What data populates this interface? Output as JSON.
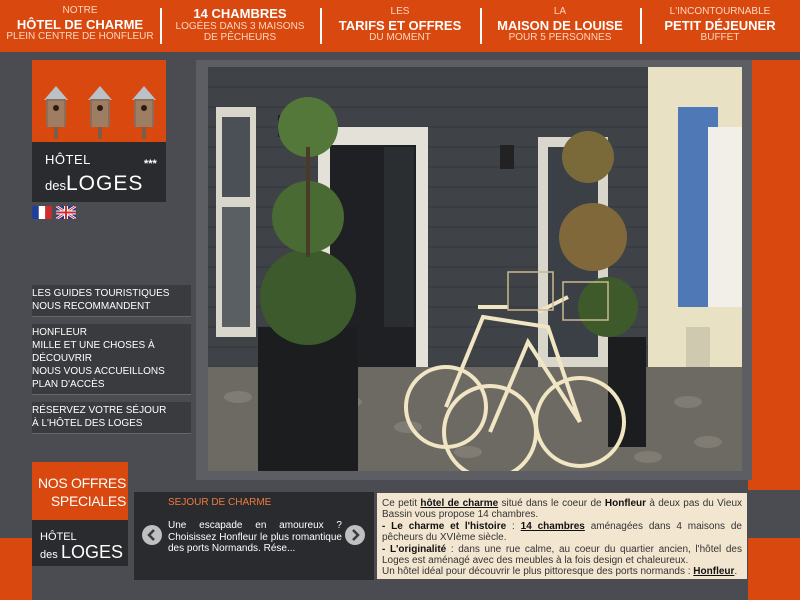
{
  "nav": [
    {
      "line1": "Notre",
      "line2": "Hôtel de charme",
      "line3": "Plein centre de Honfleur"
    },
    {
      "line1": "14 chambres",
      "line2": "logées dans 3 maisons",
      "line3": "de pêcheurs"
    },
    {
      "line1": "Les",
      "line2": "tarifs et offres",
      "line3": "du moment"
    },
    {
      "line1": "La",
      "line2": "Maison de Louise",
      "line3": "pour 5 personnes"
    },
    {
      "line1": "L'incontournable",
      "line2": "Petit Déjeuner",
      "line3": "Buffet"
    }
  ],
  "logo": {
    "hotel": "HÔTEL",
    "des": "des",
    "loges": "LOGES",
    "stars": "***"
  },
  "flags": {
    "fr": "french-flag-icon",
    "en": "uk-flag-icon"
  },
  "menu": [
    {
      "line1": "Les guides touristiques",
      "line2": "nous recommandent"
    },
    {
      "line1": "Honfleur",
      "line2": "mille et une choses à découvrir"
    },
    {
      "line1": "Nous vous accueillons",
      "line2": "plan d'accès"
    },
    {
      "line1": "Réservez votre séjour",
      "line2": "à l'hôtel des Loges"
    }
  ],
  "offers": {
    "title": "Nos offres speciales",
    "logo_hotel": "HÔTEL",
    "logo_des": "des",
    "logo_loges": "LOGES"
  },
  "slider": {
    "title": "Sejour de charme",
    "text": "Une escapade en amoureux ? Choisissez Honfleur le plus romantique des ports Normands. Rése..."
  },
  "description": {
    "p1_a": "Ce petit ",
    "p1_link": "hôtel de charme",
    "p1_b": " situé dans le coeur de ",
    "p1_bold": "Honfleur",
    "p1_c": " à deux pas du Vieux Bassin vous propose 14 chambres.",
    "p2_bold": "- Le charme et l'histoire",
    "p2_a": " : ",
    "p2_link": "14 chambres",
    "p2_b": " aménagées dans 4 maisons de pêcheurs du XVIème siècle.",
    "p3_bold": "- L'originalité",
    "p3_a": " : dans une rue calme, au coeur du quartier ancien, l'hôtel des Loges est aménagé avec des meubles à la fois design et chaleureux.",
    "p4_a": "Un hôtel idéal pour découvrir le plus pittoresque des ports normands : ",
    "p4_link": "Honfleur",
    "p4_b": "."
  },
  "colors": {
    "accent": "#d9480f",
    "background": "#4a4c52",
    "panel": "#2a2b2e",
    "cream": "#f3e6d1"
  }
}
